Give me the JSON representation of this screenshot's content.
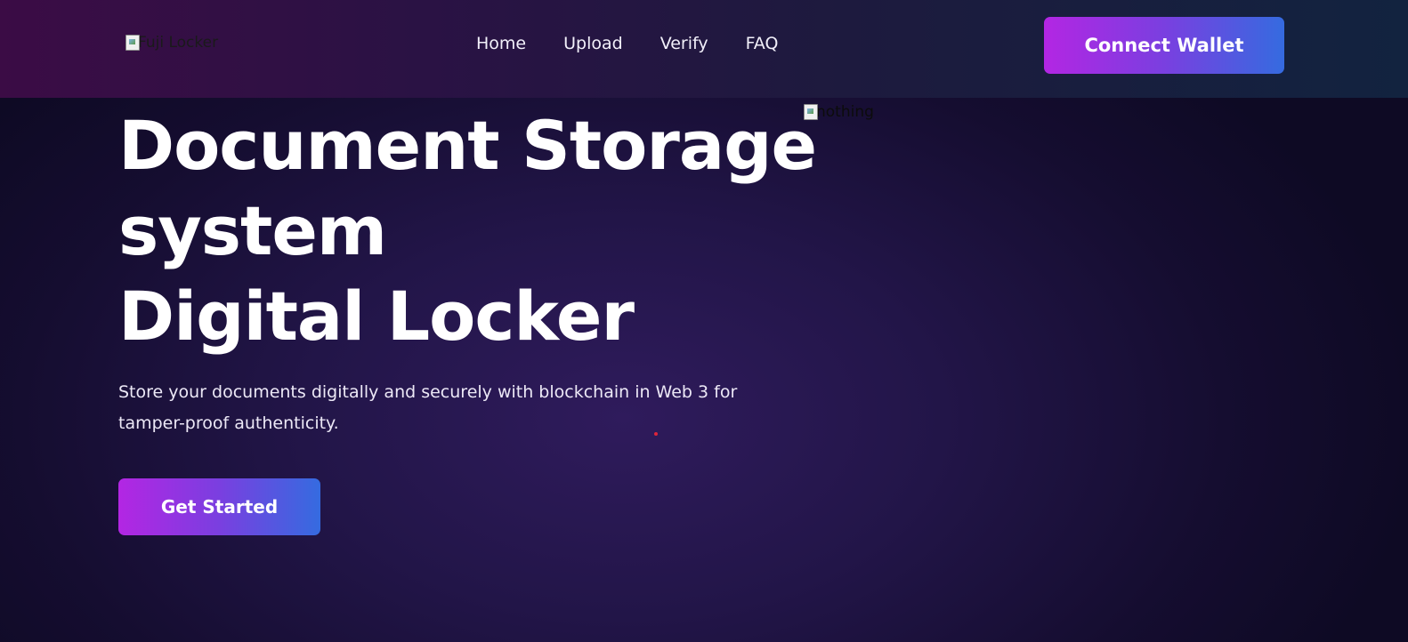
{
  "header": {
    "logo_alt": "Fuji Locker",
    "nav": [
      {
        "label": "Home"
      },
      {
        "label": "Upload"
      },
      {
        "label": "Verify"
      },
      {
        "label": "FAQ"
      }
    ],
    "connect_label": "Connect Wallet"
  },
  "hero": {
    "title_lines": [
      "Document Storage",
      "system",
      "Digital Locker"
    ],
    "description": "Store your documents digitally and securely with blockchain in Web 3 for tamper-proof authenticity.",
    "cta_label": "Get Started",
    "image_alt": "nothing"
  },
  "colors": {
    "gradient_start": "#b326e3",
    "gradient_end": "#356be0",
    "background": "#221548",
    "header_bg": "#2a1244"
  },
  "icons": {
    "broken_image": "broken-image-icon"
  }
}
